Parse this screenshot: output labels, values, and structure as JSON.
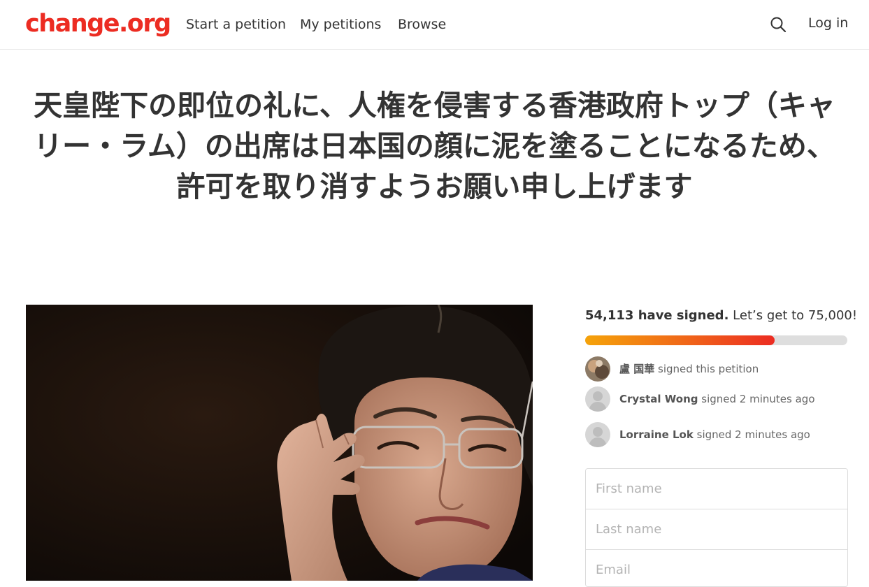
{
  "header": {
    "logo": "change.org",
    "nav": [
      {
        "label": "Start a petition"
      },
      {
        "label": "My petitions"
      },
      {
        "label": "Browse"
      }
    ],
    "search_icon": "search-icon",
    "login": "Log in"
  },
  "petition": {
    "title": "天皇陛下の即位の礼に、人権を侵害する香港政府トップ（キャリー・ラム）の出席は日本国の顔に泥を塗ることになるため、許可を取り消すようお願い申し上げます"
  },
  "progress": {
    "signed_count": "54,113 have signed.",
    "goal_text": "Let’s get to 75,000!",
    "fraction": 0.7215,
    "colors": {
      "start": "#f5a30a",
      "end": "#ec2c22",
      "track": "#dedede"
    }
  },
  "signers": [
    {
      "name": "盧 国華",
      "action": "signed this petition"
    },
    {
      "name": "Crystal Wong",
      "action": "signed 2 minutes ago"
    },
    {
      "name": "Lorraine Lok",
      "action": "signed 2 minutes ago"
    }
  ],
  "form": {
    "first_name_placeholder": "First name",
    "last_name_placeholder": "Last name",
    "email_placeholder": "Email"
  },
  "colors": {
    "brand": "#ec2c22",
    "text": "#333333"
  }
}
